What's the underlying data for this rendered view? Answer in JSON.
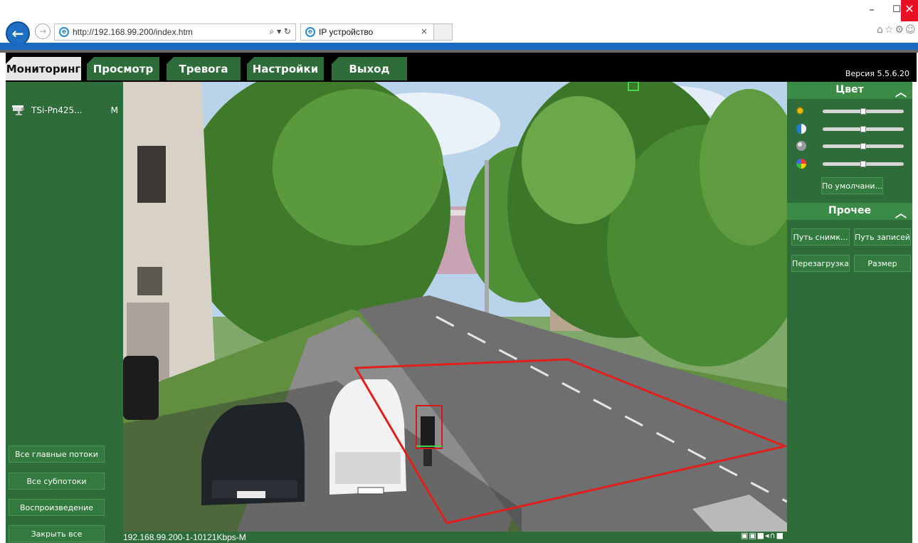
{
  "browser": {
    "url": "http://192.168.99.200/index.htm",
    "address_tools": "⌕ ▾ ↻",
    "tab_title": "IP устройство",
    "tab_close": "×",
    "window_min": "–",
    "window_max": "☐",
    "window_close": "✕",
    "toolbar_icons": "⌂☆⚙☺"
  },
  "menu": {
    "tabs": [
      {
        "label": "Мониторинг"
      },
      {
        "label": "Просмотр"
      },
      {
        "label": "Тревога"
      },
      {
        "label": "Настройки"
      },
      {
        "label": "Выход"
      }
    ],
    "active_index": 0,
    "version": "Версия 5.5.6.20"
  },
  "left_panel": {
    "device": {
      "name": "TSi-Pn425...",
      "stream": "M"
    },
    "buttons": [
      {
        "label": "Все главные потоки"
      },
      {
        "label": "Все субпотоки"
      },
      {
        "label": "Воспроизведение"
      },
      {
        "label": "Закрыть все"
      }
    ]
  },
  "video": {
    "status_text": "192.168.99.200-1-10121Kbps-M",
    "status_icons": "▣▣■◂∩■"
  },
  "right_panel": {
    "color_section": {
      "title": "Цвет",
      "caret": "︿",
      "sliders": [
        {
          "name": "brightness",
          "icon": "sun-icon",
          "value": 0.5
        },
        {
          "name": "contrast",
          "icon": "contrast-icon",
          "value": 0.5
        },
        {
          "name": "saturation",
          "icon": "saturation-icon",
          "value": 0.5
        },
        {
          "name": "hue",
          "icon": "hue-icon",
          "value": 0.5
        }
      ],
      "default_button": "По умолчани..."
    },
    "other_section": {
      "title": "Прочее",
      "caret": "︿",
      "buttons": [
        {
          "label": "Путь снимк..."
        },
        {
          "label": "Путь записей"
        },
        {
          "label": "Перезагрузка"
        },
        {
          "label": "Размер"
        }
      ]
    }
  },
  "colors": {
    "panel_green": "#2e6d3a",
    "header_black": "#000000",
    "detection_line": "#e0201b",
    "person_box": "#d11a1a"
  }
}
